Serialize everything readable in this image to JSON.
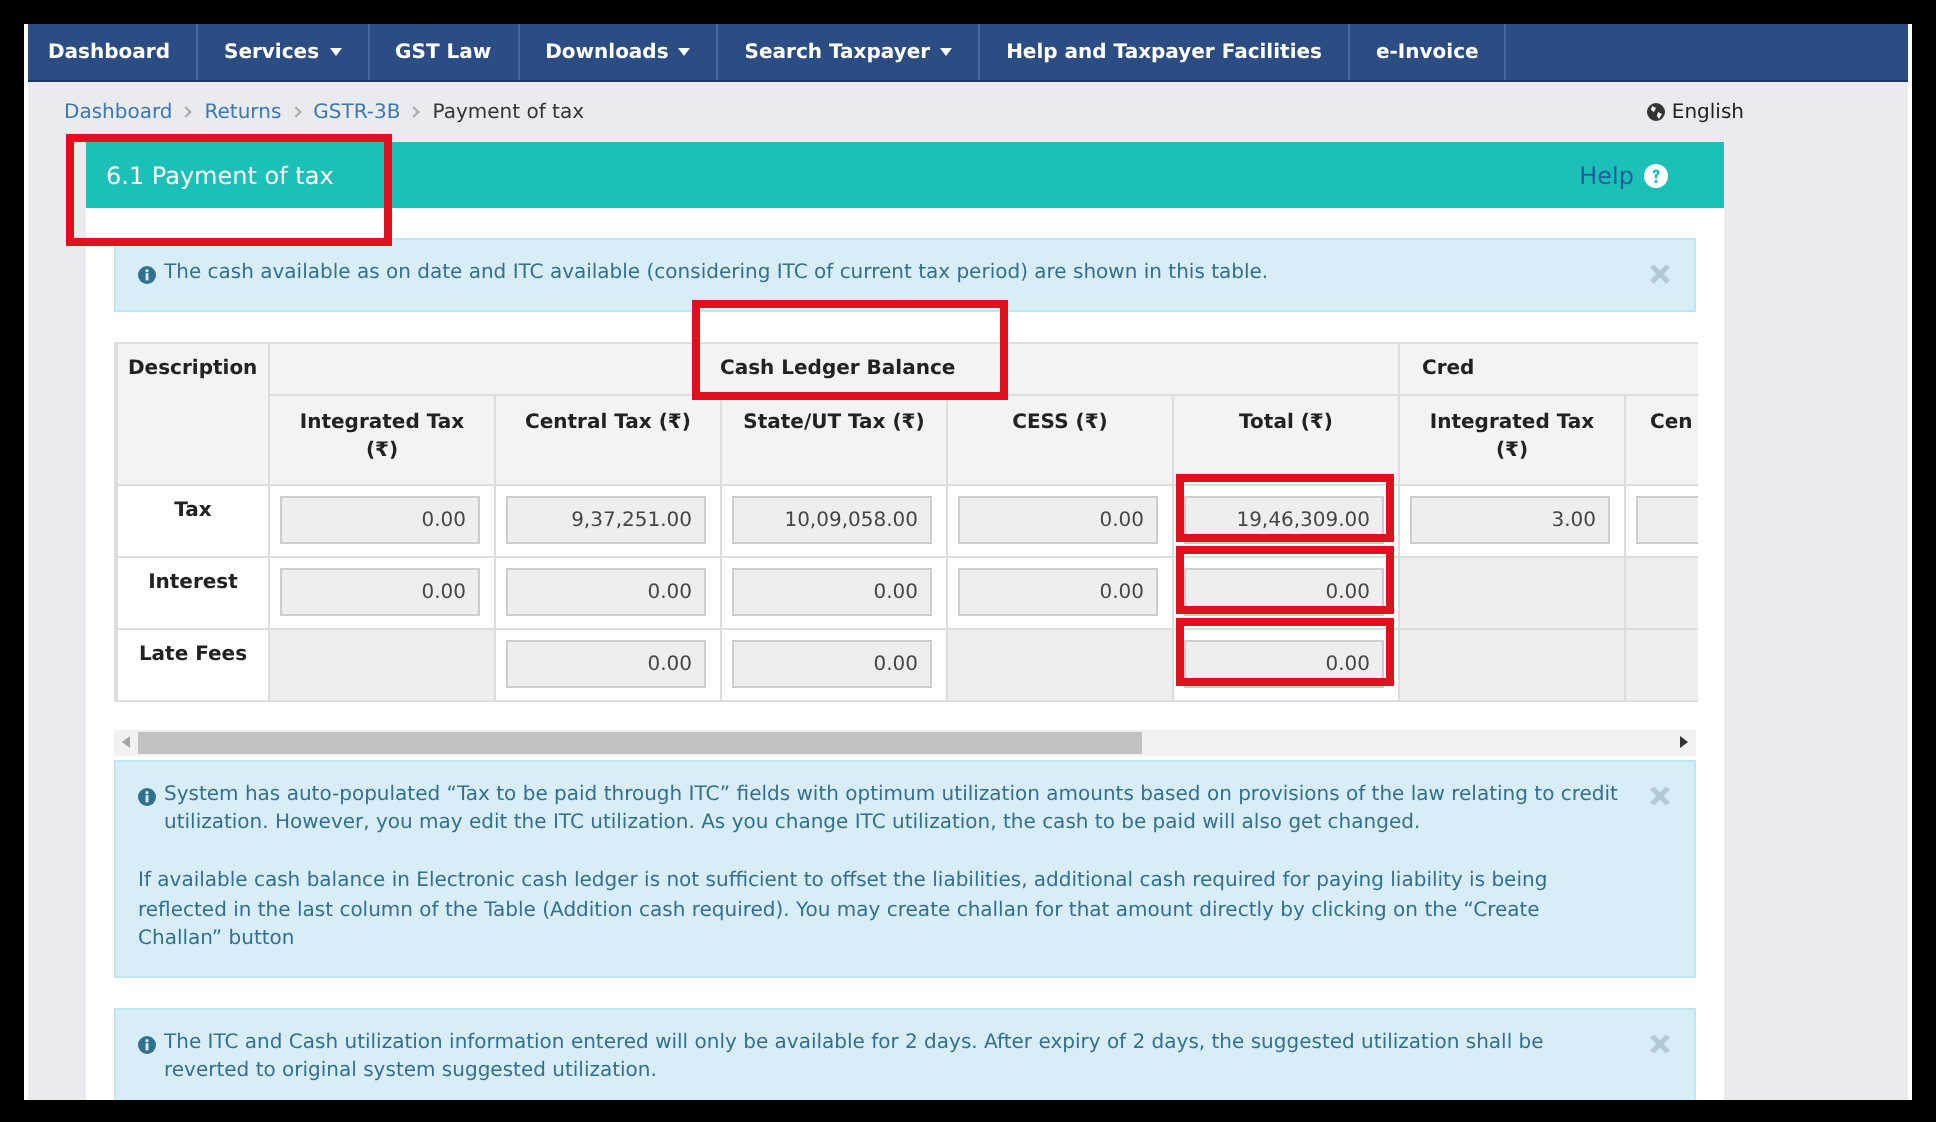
{
  "nav": {
    "items": [
      {
        "label": "Dashboard",
        "dropdown": false
      },
      {
        "label": "Services",
        "dropdown": true
      },
      {
        "label": "GST Law",
        "dropdown": false
      },
      {
        "label": "Downloads",
        "dropdown": true
      },
      {
        "label": "Search Taxpayer",
        "dropdown": true
      },
      {
        "label": "Help and Taxpayer Facilities",
        "dropdown": false
      },
      {
        "label": "e-Invoice",
        "dropdown": false
      }
    ]
  },
  "breadcrumb": {
    "links": [
      "Dashboard",
      "Returns",
      "GSTR-3B"
    ],
    "current": "Payment of tax"
  },
  "language": "English",
  "panel": {
    "title": "6.1 Payment of tax",
    "title_highlighted": true,
    "help": "Help"
  },
  "info_top": {
    "paragraphs": [
      "The cash available as on date and ITC available (considering ITC of current tax period) are shown in this table."
    ]
  },
  "table": {
    "description_header": "Description",
    "groups": [
      {
        "label": "Cash Ledger Balance",
        "highlighted": true,
        "columns": [
          "Integrated Tax (₹)",
          "Central Tax (₹)",
          "State/UT Tax (₹)",
          "CESS (₹)",
          "Total (₹)"
        ]
      },
      {
        "label": "Cred",
        "highlighted": false,
        "columns": [
          "Integrated Tax (₹)",
          "Cen"
        ]
      }
    ],
    "rows": [
      {
        "label": "Tax",
        "cells": [
          {
            "kind": "field",
            "value": "0.00",
            "highlighted": false
          },
          {
            "kind": "field",
            "value": "9,37,251.00",
            "highlighted": false
          },
          {
            "kind": "field",
            "value": "10,09,058.00",
            "highlighted": false
          },
          {
            "kind": "field",
            "value": "0.00",
            "highlighted": false
          },
          {
            "kind": "field",
            "value": "19,46,309.00",
            "highlighted": true
          },
          {
            "kind": "field",
            "value": "3.00",
            "highlighted": false
          },
          {
            "kind": "field"
          }
        ]
      },
      {
        "label": "Interest",
        "cells": [
          {
            "kind": "field",
            "value": "0.00",
            "highlighted": false
          },
          {
            "kind": "field",
            "value": "0.00",
            "highlighted": false
          },
          {
            "kind": "field",
            "value": "0.00",
            "highlighted": false
          },
          {
            "kind": "field",
            "value": "0.00",
            "highlighted": false
          },
          {
            "kind": "field",
            "value": "0.00",
            "highlighted": true
          },
          {
            "kind": "blank"
          },
          {
            "kind": "blank"
          }
        ]
      },
      {
        "label": "Late Fees",
        "cells": [
          {
            "kind": "blank"
          },
          {
            "kind": "field",
            "value": "0.00",
            "highlighted": false
          },
          {
            "kind": "field",
            "value": "0.00",
            "highlighted": false
          },
          {
            "kind": "blank"
          },
          {
            "kind": "field",
            "value": "0.00",
            "highlighted": true
          },
          {
            "kind": "blank"
          },
          {
            "kind": "blank"
          }
        ]
      }
    ]
  },
  "info_middle": {
    "paragraphs": [
      "System has auto-populated “Tax to be paid through ITC” fields with optimum utilization amounts based on provisions of the law relating to credit utilization. However, you may edit the ITC utilization. As you change ITC utilization, the cash to be paid will also get changed.",
      "If available cash balance in Electronic cash ledger is not sufficient to offset the liabilities, additional cash required for paying liability is being reflected in the last column of the Table (Addition cash required). You may create challan for that amount directly by clicking on the “Create Challan” button"
    ]
  },
  "info_bottom": {
    "paragraphs": [
      "The ITC and Cash utilization information entered will only be available for 2 days. After expiry of 2 days, the suggested utilization shall be reverted to original system suggested utilization."
    ]
  }
}
